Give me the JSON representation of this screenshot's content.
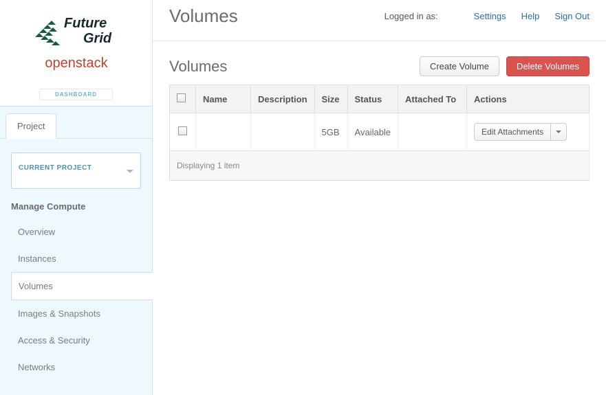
{
  "brand": {
    "line1": "Future",
    "line2": "Grid",
    "line3": "openstack",
    "badge": "DASHBOARD"
  },
  "sidebar": {
    "tab": "Project",
    "current_project_label": "CURRENT PROJECT",
    "section": "Manage Compute",
    "items": [
      {
        "label": "Overview"
      },
      {
        "label": "Instances"
      },
      {
        "label": "Volumes"
      },
      {
        "label": "Images & Snapshots"
      },
      {
        "label": "Access & Security"
      },
      {
        "label": "Networks"
      }
    ]
  },
  "topbar": {
    "title": "Volumes",
    "logged_in_label": "Logged in as:",
    "links": {
      "settings": "Settings",
      "help": "Help",
      "signout": "Sign Out"
    }
  },
  "panel": {
    "title": "Volumes",
    "create_btn": "Create Volume",
    "delete_btn": "Delete Volumes"
  },
  "table": {
    "headers": {
      "name": "Name",
      "description": "Description",
      "size": "Size",
      "status": "Status",
      "attached": "Attached To",
      "actions": "Actions"
    },
    "rows": [
      {
        "name": "",
        "description": "",
        "size": "5GB",
        "status": "Available",
        "attached": "",
        "action": "Edit Attachments"
      }
    ],
    "footer": "Displaying 1 item"
  }
}
